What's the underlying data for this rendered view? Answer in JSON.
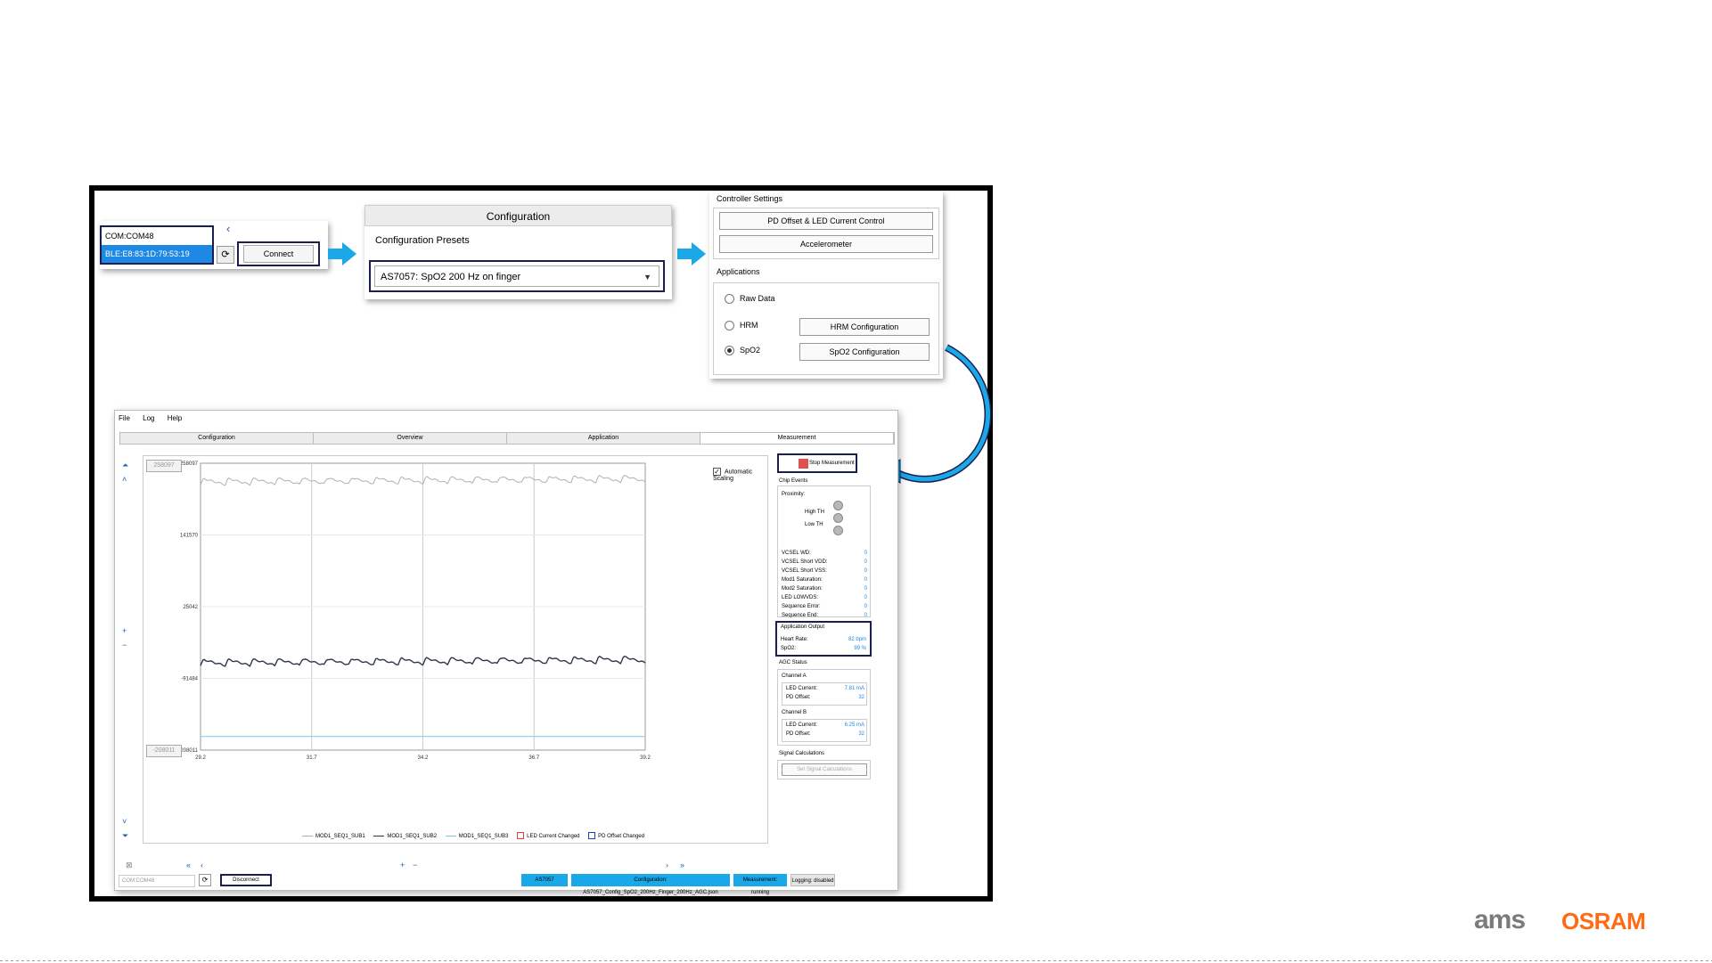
{
  "com_panel": {
    "items": [
      "COM:COM48",
      "BLE:E8:83:1D:79:53:19"
    ],
    "connect_label": "Connect"
  },
  "configuration": {
    "title": "Configuration",
    "presets_label": "Configuration Presets",
    "selected_preset": "AS7057: SpO2 200 Hz on finger"
  },
  "controller": {
    "settings_label": "Controller Settings",
    "pd_offset_label": "PD Offset & LED Current Control",
    "accelerometer_label": "Accelerometer",
    "applications_label": "Applications",
    "apps": [
      {
        "label": "Raw Data",
        "selected": false
      },
      {
        "label": "HRM",
        "selected": false,
        "config": "HRM Configuration"
      },
      {
        "label": "SpO2",
        "selected": true,
        "config": "SpO2 Configuration"
      }
    ]
  },
  "app": {
    "menu": [
      "File",
      "Log",
      "Help"
    ],
    "tabs": [
      "Configuration",
      "Overview",
      "Application",
      "Measurement"
    ],
    "active_tab": "Measurement",
    "scale_top": "258097",
    "scale_bottom": "-208011",
    "auto_scaling_label": "Automatic Scaling",
    "y_ticks": [
      "258097",
      "141570",
      "25042",
      "-91484",
      "-208011"
    ],
    "x_ticks": [
      "29.2",
      "31.7",
      "34.2",
      "36.7",
      "39.2"
    ],
    "legend": [
      {
        "label": "MOD1_SEQ1_SUB1",
        "color": "#b0b0b0",
        "kind": "line"
      },
      {
        "label": "MOD1_SEQ1_SUB2",
        "color": "#2d3748",
        "kind": "line"
      },
      {
        "label": "MOD1_SEQ1_SUB3",
        "color": "#7fc7e8",
        "kind": "line"
      },
      {
        "label": "LED Current Changed",
        "color": "#e53935",
        "kind": "box"
      },
      {
        "label": "PD Offset Changed",
        "color": "#1e3aa8",
        "kind": "box"
      }
    ],
    "stop_label": "Stop Measurement",
    "chip_events_label": "Chip Events",
    "proximity_label": "Proximity:",
    "high_th": "High TH",
    "low_th": "Low TH",
    "chip_events": [
      {
        "k": "VCSEL WD:",
        "v": "0"
      },
      {
        "k": "VCSEL Short VDD:",
        "v": "0"
      },
      {
        "k": "VCSEL Short VSS:",
        "v": "0"
      },
      {
        "k": "Mod1 Saturation:",
        "v": "0"
      },
      {
        "k": "Mod2 Saturation:",
        "v": "0"
      },
      {
        "k": "LED LOWVDS:",
        "v": "0"
      },
      {
        "k": "Sequence Error:",
        "v": "0"
      },
      {
        "k": "Sequence End:",
        "v": "0"
      }
    ],
    "app_output_label": "Application Output",
    "heart_rate_label": "Heart Rate:",
    "heart_rate_value": "82 bpm",
    "spo2_label": "SpO2:",
    "spo2_value": "99 %",
    "agc_label": "AGC Status",
    "channel_a_label": "Channel A",
    "channel_a_led_label": "LED Current:",
    "channel_a_led": "7.81 mA",
    "channel_a_pd_label": "PD Offset:",
    "channel_a_pd": "32",
    "channel_b_label": "Channel B",
    "channel_b_led_label": "LED Current:",
    "channel_b_led": "6.25 mA",
    "channel_b_pd_label": "PD Offset:",
    "channel_b_pd": "32",
    "signal_calc_label": "Signal Calculations",
    "set_signal_calc_label": "Set Signal Calculations",
    "status_com": "COM:COM48",
    "disconnect_label": "Disconnect",
    "status_device": "AS7057",
    "status_config": "Configuration: AS7057_Config_SpO2_200Hz_Finger_200Hz_AGC.json",
    "status_measurement": "Measurement: running",
    "status_logging": "Logging: disabled"
  },
  "chart_data": {
    "type": "line",
    "x_range": [
      29.2,
      39.2
    ],
    "y_range": [
      -208011,
      258097
    ],
    "series": [
      {
        "name": "MOD1_SEQ1_SUB1",
        "approx_level": 228000,
        "sawtooth_amplitude": 10000
      },
      {
        "name": "MOD1_SEQ1_SUB2",
        "approx_level": -66000,
        "sawtooth_amplitude": 10000
      },
      {
        "name": "MOD1_SEQ1_SUB3",
        "approx_level": -186000
      }
    ],
    "cycles": 18
  },
  "logo": {
    "am": "ams",
    "osram": "OSRAM"
  },
  "colors": {
    "accent": "#1aa8e8",
    "highlight": "#1a1f4e",
    "brand_orange": "#ff6a13"
  }
}
